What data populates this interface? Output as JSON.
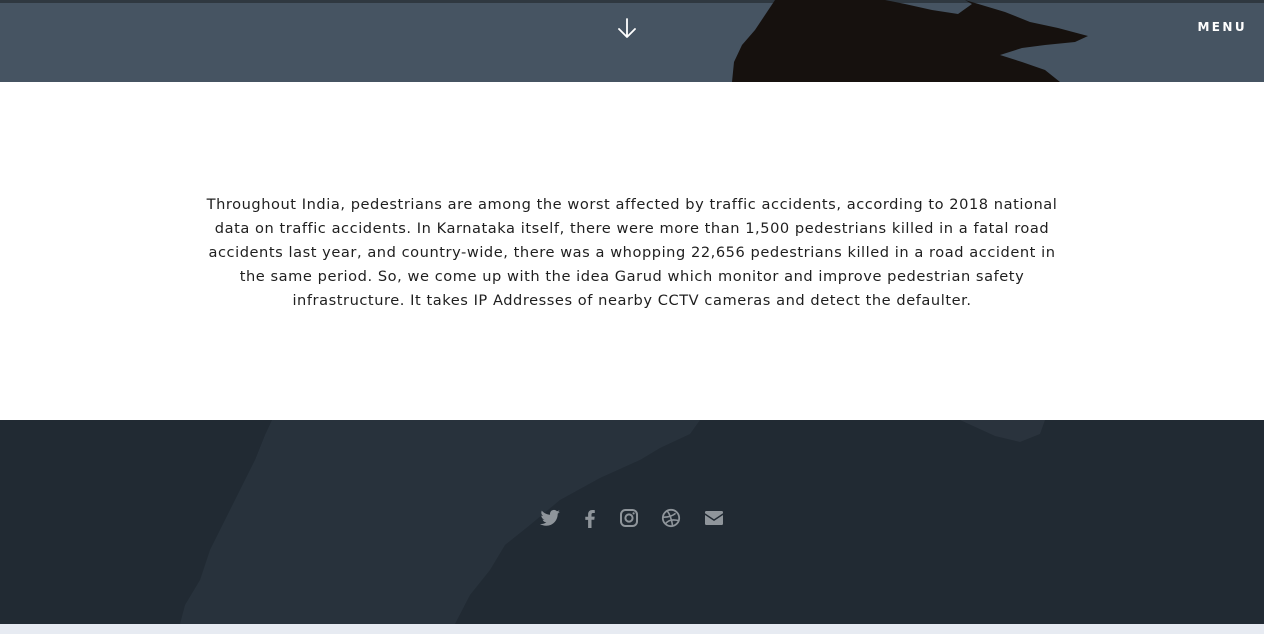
{
  "header": {
    "menu_label": "MENU",
    "scroll_icon": "arrow-down-icon",
    "background_color": "#465462"
  },
  "main": {
    "description": "Throughout India, pedestrians are among the worst affected by traffic accidents, according to 2018 national data on traffic accidents. In Karnataka itself, there were more than 1,500 pedestrians killed in a fatal road accidents last year, and country-wide, there was a whopping 22,656 pedestrians killed in a road accident in the same period. So, we come up with the idea Garud which monitor and improve pedestrian safety infrastructure. It takes IP Addresses of nearby CCTV cameras and detect the defaulter."
  },
  "footer": {
    "background_color": "#212a33",
    "icon_color": "#8f959b",
    "social_icons": [
      "twitter-icon",
      "facebook-icon",
      "instagram-icon",
      "dribbble-icon",
      "envelope-icon"
    ]
  }
}
